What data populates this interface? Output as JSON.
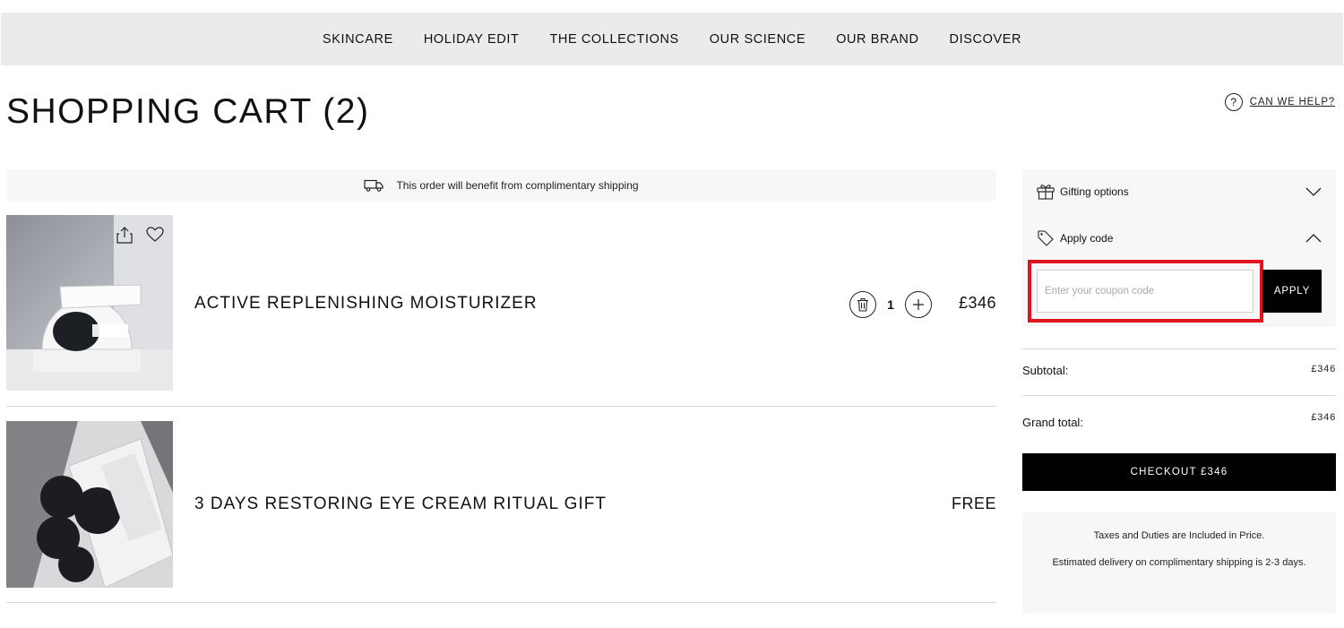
{
  "nav": [
    "SKINCARE",
    "HOLIDAY EDIT",
    "THE COLLECTIONS",
    "OUR SCIENCE",
    "OUR BRAND",
    "DISCOVER"
  ],
  "page": {
    "title": "SHOPPING CART (2)",
    "help_label": "CAN WE HELP?"
  },
  "shipping_notice": "This order will benefit from complimentary shipping",
  "items": [
    {
      "name": "ACTIVE REPLENISHING MOISTURIZER",
      "quantity": "1",
      "price": "£346"
    },
    {
      "name": "3 DAYS RESTORING EYE CREAM RITUAL GIFT",
      "price": "FREE"
    }
  ],
  "sidebar": {
    "gifting_label": "Gifting options",
    "code_label": "Apply code",
    "coupon_placeholder": "Enter your coupon code",
    "apply_label": "APPLY",
    "subtotal_label": "Subtotal:",
    "subtotal_value": "£346",
    "grand_total_label": "Grand total:",
    "grand_total_value": "£346",
    "checkout_label": "CHECKOUT  £346",
    "info_taxes": "Taxes and Duties are Included in Price.",
    "info_delivery": "Estimated delivery on complimentary shipping is 2-3 days."
  },
  "colors": {
    "highlight": "#e0131e",
    "nav_bg": "#ebebeb",
    "panel_bg": "#f7f7f7",
    "button_bg": "#000000"
  },
  "icons": [
    "help-icon",
    "truck-icon",
    "share-icon",
    "heart-icon",
    "trash-icon",
    "plus-icon",
    "gift-icon",
    "tag-icon",
    "chevron-down-icon",
    "chevron-up-icon"
  ]
}
